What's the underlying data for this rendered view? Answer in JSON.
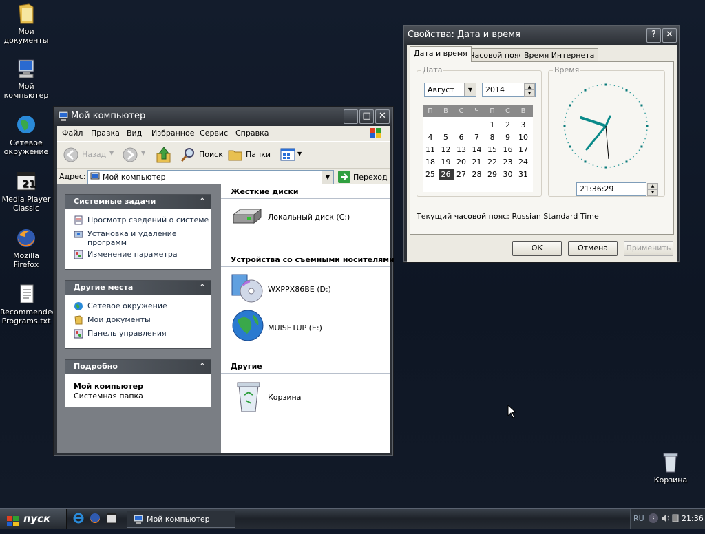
{
  "desktop_icons": {
    "my_documents": "Мои документы",
    "my_computer": "Мой компьютер",
    "network": "Сетевое окружение",
    "mpc": "Media Player Classic",
    "firefox": "Mozilla Firefox",
    "recommended": "Recommended Programs.txt",
    "recycle": "Корзина"
  },
  "explorer": {
    "title": "Мой компьютер",
    "menu": [
      "Файл",
      "Правка",
      "Вид",
      "Избранное",
      "Сервис",
      "Справка"
    ],
    "toolbar": {
      "back": "Назад",
      "search": "Поиск",
      "folders": "Папки"
    },
    "address_label": "Адрес:",
    "address_value": "Мой компьютер",
    "go_label": "Переход",
    "system_tasks": {
      "title": "Системные задачи",
      "items": [
        "Просмотр сведений о системе",
        "Установка и удаление программ",
        "Изменение параметра"
      ]
    },
    "other_places": {
      "title": "Другие места",
      "items": [
        "Сетевое окружение",
        "Мои документы",
        "Панель управления"
      ]
    },
    "details": {
      "title": "Подробно",
      "name": "Мой компьютер",
      "desc": "Системная папка"
    },
    "sections": {
      "hdd": "Жесткие диски",
      "removable": "Устройства со съемными носителями",
      "other": "Другие"
    },
    "drives": {
      "c": "Локальный диск (C:)",
      "d": "WXPPX86BE (D:)",
      "e": "MUISETUP (E:)",
      "recycle": "Корзина"
    }
  },
  "dialog": {
    "title": "Свойства: Дата и время",
    "tabs": [
      "Дата и время",
      "Часовой пояс",
      "Время Интернета"
    ],
    "date_group": "Дата",
    "time_group": "Время",
    "month": "Август",
    "year": "2014",
    "weekdays": [
      "П",
      "В",
      "С",
      "Ч",
      "П",
      "С",
      "В"
    ],
    "days": [
      "",
      "",
      "",
      "",
      "1",
      "2",
      "3",
      "4",
      "5",
      "6",
      "7",
      "8",
      "9",
      "10",
      "11",
      "12",
      "13",
      "14",
      "15",
      "16",
      "17",
      "18",
      "19",
      "20",
      "21",
      "22",
      "23",
      "24",
      "25",
      "26",
      "27",
      "28",
      "29",
      "30",
      "31"
    ],
    "selected_day": "26",
    "time_value": "21:36:29",
    "timezone_text": "Текущий часовой пояс: Russian Standard Time",
    "buttons": {
      "ok": "ОК",
      "cancel": "Отмена",
      "apply": "Применить"
    }
  },
  "taskbar": {
    "start": "пуск",
    "task": "Мой компьютер",
    "lang": "RU",
    "clock": "21:36"
  }
}
